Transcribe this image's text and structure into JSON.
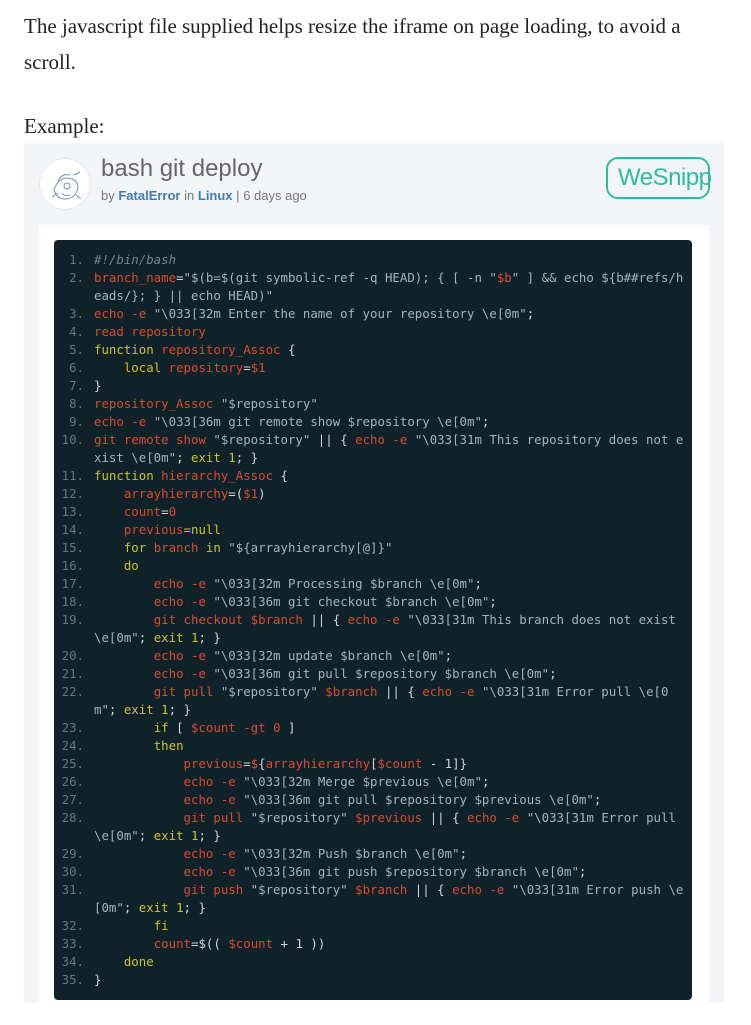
{
  "intro_text": "The javascript file supplied helps resize the iframe on page loading, to avoid a scroll.",
  "example_label": "Example:",
  "snippet": {
    "title": "bash git deploy",
    "by": "by",
    "author": "FatalError",
    "in": "in",
    "category": "Linux",
    "separator": "|",
    "time_ago": "6 days ago",
    "logo_text": "WeSnipp",
    "logo_color": "#2bbf9a",
    "code_bg": "#0f2129"
  },
  "line_numbers": [
    "1.",
    "2.",
    "3.",
    "4.",
    "5.",
    "6.",
    "7.",
    "8.",
    "9.",
    "10.",
    "11.",
    "12.",
    "13.",
    "14.",
    "15.",
    "16.",
    "17.",
    "18.",
    "19.",
    "20.",
    "21.",
    "22.",
    "23.",
    "24.",
    "25.",
    "26.",
    "27.",
    "28.",
    "29.",
    "30.",
    "31.",
    "32.",
    "33.",
    "34.",
    "35."
  ],
  "code": {
    "l1": "#!/bin/bash",
    "l2a": "branch_name",
    "l2b": "=",
    "l2c": "\"$(b=$(git symbolic-ref -q HEAD); { [ -n \"",
    "l2d": "$b",
    "l2e": "\" ] && echo ${b##refs/heads/}; } || echo HEAD)\"",
    "l3a": "echo",
    "l3b": " -e ",
    "l3c": "\"\\033[32m Enter the name of your repository \\e[0m\"",
    "l3d": ";",
    "l4": "read repository",
    "l5a": "function",
    "l5b": " repository_Assoc ",
    "l5c": "{",
    "l6a": "    local ",
    "l6b": "repository",
    "l6c": "=",
    "l6d": "$1",
    "l7": "}",
    "l8a": "repository_Assoc ",
    "l8b": "\"$repository\"",
    "l9a": "echo",
    "l9b": " -e ",
    "l9c": "\"\\033[36m git remote show $repository \\e[0m\"",
    "l9d": ";",
    "l10a": "git remote show ",
    "l10b": "\"$repository\"",
    "l10c": " || { ",
    "l10d": "echo",
    "l10e": " -e ",
    "l10f": "\"\\033[31m This repository does not exist \\e[0m\"",
    "l10g": "; ",
    "l10h": "exit",
    "l10i": " 1",
    "l10j": "; }",
    "l11a": "function",
    "l11b": " hierarchy_Assoc ",
    "l11c": "{",
    "l12a": "    arrayhierarchy",
    "l12b": "=(",
    "l12c": "$1",
    "l12d": ")",
    "l13a": "    count",
    "l13b": "=",
    "l13c": "0",
    "l14a": "    previous",
    "l14b": "=null",
    "l15a": "    for",
    "l15b": " branch ",
    "l15c": "in",
    "l15d": " \"${arrayhierarchy[@]}\"",
    "l16": "    do",
    "l17a": "        echo",
    "l17b": " -e ",
    "l17c": "\"\\033[32m Processing $branch \\e[0m\"",
    "l17d": ";",
    "l18a": "        echo",
    "l18b": " -e ",
    "l18c": "\"\\033[36m git checkout $branch \\e[0m\"",
    "l18d": ";",
    "l19a": "        git checkout ",
    "l19b": "$branch",
    "l19c": " || { ",
    "l19d": "echo",
    "l19e": " -e ",
    "l19f": "\"\\033[31m This branch does not exist \\e[0m\"",
    "l19g": "; ",
    "l19h": "exit",
    "l19i": " 1",
    "l19j": "; }",
    "l20a": "        echo",
    "l20b": " -e ",
    "l20c": "\"\\033[32m update $branch \\e[0m\"",
    "l20d": ";",
    "l21a": "        echo",
    "l21b": " -e ",
    "l21c": "\"\\033[36m git pull $repository $branch \\e[0m\"",
    "l21d": ";",
    "l22a": "        git pull ",
    "l22b": "\"$repository\"",
    "l22c": " $branch",
    "l22d": " || { ",
    "l22e": "echo",
    "l22f": " -e ",
    "l22g": "\"\\033[31m Error pull \\e[0m\"",
    "l22h": "; ",
    "l22i": "exit",
    "l22j": " 1",
    "l22k": "; }",
    "l23a": "        if",
    "l23b": " [ ",
    "l23c": "$count",
    "l23d": " -gt ",
    "l23e": "0",
    "l23f": " ]",
    "l24": "        then",
    "l25a": "            previous",
    "l25b": "=",
    "l25c": "$",
    "l25d": "{",
    "l25e": "arrayhierarchy",
    "l25f": "[",
    "l25g": "$count",
    "l25h": " - 1]}",
    "l26a": "            echo",
    "l26b": " -e ",
    "l26c": "\"\\033[32m Merge $previous \\e[0m\"",
    "l26d": ";",
    "l27a": "            echo",
    "l27b": " -e ",
    "l27c": "\"\\033[36m git pull $repository $previous \\e[0m\"",
    "l27d": ";",
    "l28a": "            git pull ",
    "l28b": "\"$repository\"",
    "l28c": " $previous",
    "l28d": " || { ",
    "l28e": "echo",
    "l28f": " -e ",
    "l28g": "\"\\033[31m Error pull \\e[0m\"",
    "l28h": "; ",
    "l28i": "exit",
    "l28j": " 1",
    "l28k": "; }",
    "l29a": "            echo",
    "l29b": " -e ",
    "l29c": "\"\\033[32m Push $branch \\e[0m\"",
    "l29d": ";",
    "l30a": "            echo",
    "l30b": " -e ",
    "l30c": "\"\\033[36m git push $repository $branch \\e[0m\"",
    "l30d": ";",
    "l31a": "            git push ",
    "l31b": "\"$repository\"",
    "l31c": " $branch",
    "l31d": " || { ",
    "l31e": "echo",
    "l31f": " -e ",
    "l31g": "\"\\033[31m Error push \\e[0m\"",
    "l31h": "; ",
    "l31i": "exit",
    "l31j": " 1",
    "l31k": "; }",
    "l32": "        fi",
    "l33a": "        count",
    "l33b": "=$(( ",
    "l33c": "$count",
    "l33d": " + 1 ))",
    "l34": "    done",
    "l35": "}"
  }
}
